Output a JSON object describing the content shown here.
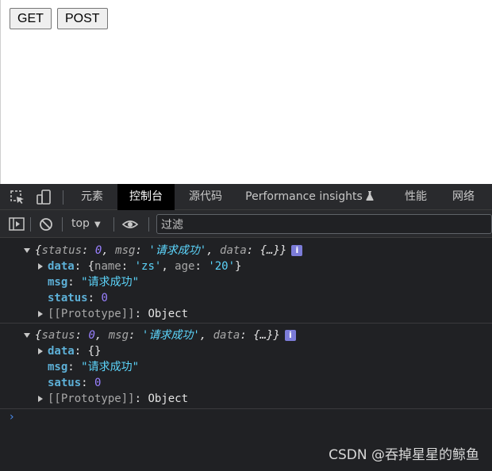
{
  "page": {
    "get_label": "GET",
    "post_label": "POST"
  },
  "devtools": {
    "tabs": [
      {
        "label": "元素"
      },
      {
        "label": "控制台"
      },
      {
        "label": "源代码"
      },
      {
        "label": "Performance insights"
      },
      {
        "label": "性能"
      },
      {
        "label": "网络"
      }
    ],
    "context": "top",
    "filter_placeholder": "过滤"
  },
  "console": {
    "entries": [
      {
        "summary": {
          "k1": "status",
          "v1": "0",
          "k2": "msg",
          "v2": "'请求成功'",
          "k3": "data",
          "v3": "{…}"
        },
        "props": [
          {
            "key": "data",
            "preview_open": "{",
            "name_key": "name",
            "name_val": "'zs'",
            "age_key": "age",
            "age_val": "'20'",
            "preview_close": "}"
          },
          {
            "key": "msg",
            "value": "\"请求成功\""
          },
          {
            "key": "status",
            "value": "0"
          },
          {
            "key": "[[Prototype]]",
            "value": "Object"
          }
        ]
      },
      {
        "summary": {
          "k1": "satus",
          "v1": "0",
          "k2": "msg",
          "v2": "'请求成功'",
          "k3": "data",
          "v3": "{…}"
        },
        "props": [
          {
            "key": "data",
            "value": "{}"
          },
          {
            "key": "msg",
            "value": "\"请求成功\""
          },
          {
            "key": "satus",
            "value": "0"
          },
          {
            "key": "[[Prototype]]",
            "value": "Object"
          }
        ]
      }
    ],
    "prompt": "›"
  },
  "watermark": "CSDN @吞掉星星的鲸鱼"
}
